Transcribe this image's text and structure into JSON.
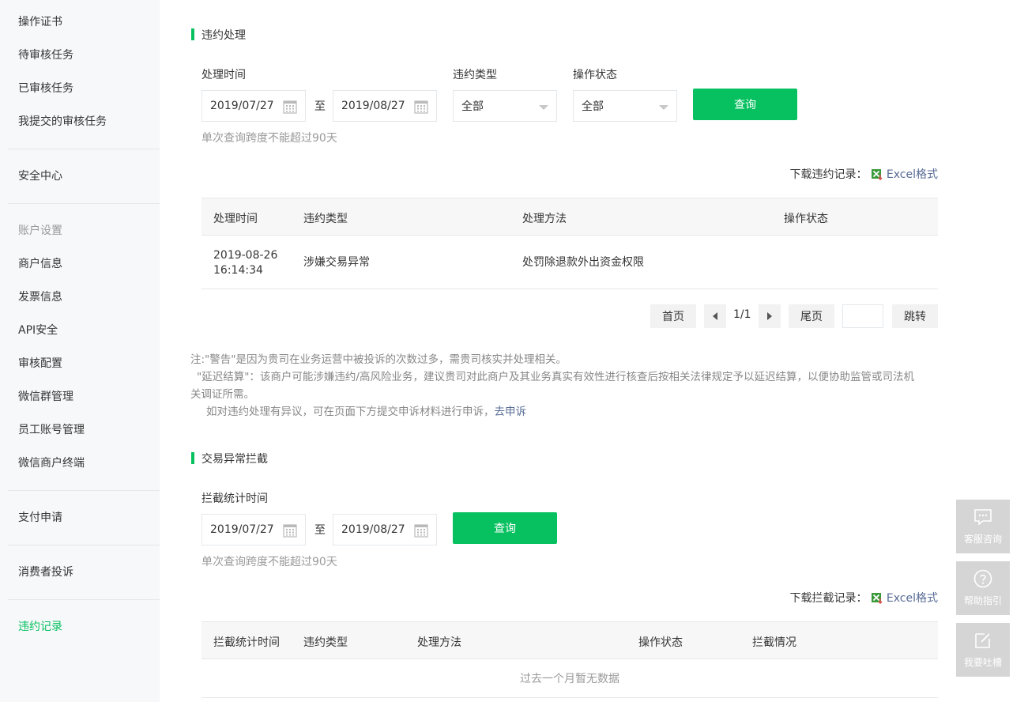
{
  "sidebar": {
    "items": [
      {
        "label": "操作证书"
      },
      {
        "label": "待审核任务"
      },
      {
        "label": "已审核任务"
      },
      {
        "label": "我提交的审核任务"
      },
      {
        "label": "安全中心"
      },
      {
        "label": "账户设置"
      },
      {
        "label": "商户信息"
      },
      {
        "label": "发票信息"
      },
      {
        "label": "API安全"
      },
      {
        "label": "审核配置"
      },
      {
        "label": "微信群管理"
      },
      {
        "label": "员工账号管理"
      },
      {
        "label": "微信商户终端"
      },
      {
        "label": "支付申请"
      },
      {
        "label": "消费者投诉"
      },
      {
        "label": "违约记录"
      }
    ]
  },
  "violation": {
    "title": "违约处理",
    "time_label": "处理时间",
    "start_date": "2019/07/27",
    "to": "至",
    "end_date": "2019/08/27",
    "type_label": "违约类型",
    "type_value": "全部",
    "status_label": "操作状态",
    "status_value": "全部",
    "query": "查询",
    "hint": "单次查询跨度不能超过90天",
    "download_label": "下载违约记录：",
    "download_link": "Excel格式",
    "columns": [
      "处理时间",
      "违约类型",
      "处理方法",
      "操作状态"
    ],
    "rows": [
      {
        "time_line1": "2019-08-26",
        "time_line2": "16:14:34",
        "type": "涉嫌交易异常",
        "method": "处罚除退款外出资金权限",
        "status": ""
      }
    ],
    "pagination": {
      "first": "首页",
      "page": "1/1",
      "last": "尾页",
      "jump": "跳转"
    }
  },
  "notes": {
    "line1": "注:\"警告\"是因为贵司在业务运营中被投诉的次数过多，需贵司核实并处理相关。",
    "line2": "\"延迟结算\"：该商户可能涉嫌违约/高风险业务，建议贵司对此商户及其业务真实有效性进行核查后按相关法律规定予以延迟结算，以便协助监管或司法机",
    "line3": "关调证所需。",
    "line4_prefix": "如对违约处理有异议，可在页面下方提交申诉材料进行申诉，",
    "line4_link": "去申诉"
  },
  "intercept": {
    "title": "交易异常拦截",
    "time_label": "拦截统计时间",
    "start_date": "2019/07/27",
    "to": "至",
    "end_date": "2019/08/27",
    "query": "查询",
    "hint": "单次查询跨度不能超过90天",
    "download_label": "下载拦截记录：",
    "download_link": "Excel格式",
    "columns": [
      "拦截统计时间",
      "违约类型",
      "处理方法",
      "操作状态",
      "拦截情况"
    ],
    "empty": "过去一个月暂无数据"
  },
  "float": {
    "service": "客服咨询",
    "help": "帮助指引",
    "feedback": "我要吐槽"
  },
  "colors": {
    "accent": "#07c160",
    "link": "#576b95",
    "sidebar_bg": "#f6f8f9"
  }
}
